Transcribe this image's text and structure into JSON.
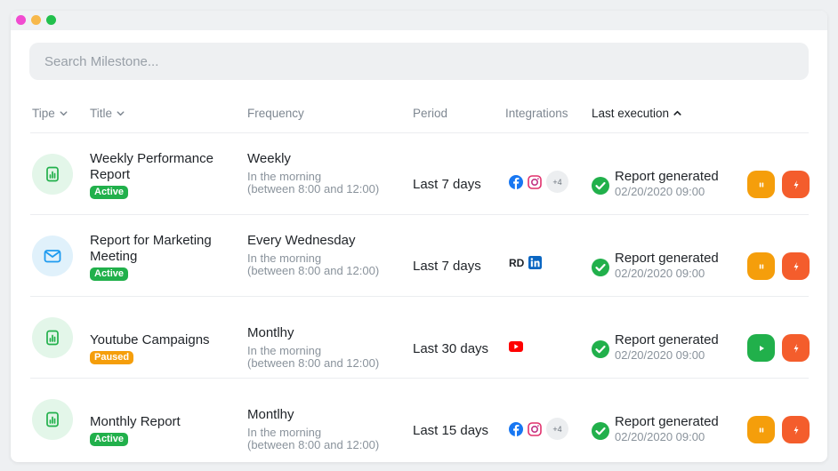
{
  "window": {
    "dots": [
      {
        "name": "close",
        "color": "#f14bd0"
      },
      {
        "name": "minimize",
        "color": "#f7b84b"
      },
      {
        "name": "maximize",
        "color": "#22c04d"
      }
    ]
  },
  "search": {
    "placeholder": "Search Milestone..."
  },
  "columns": {
    "tipe": "Tipe",
    "title": "Title",
    "frequency": "Frequency",
    "period": "Period",
    "integrations": "Integrations",
    "last_execution": "Last execution"
  },
  "colors": {
    "active": "#21b04b",
    "paused": "#f59e0b",
    "pause_btn": "#f59e0b",
    "play_btn": "#21b04b",
    "trigger_btn": "#f45d2c",
    "check": "#21b04b"
  },
  "rows": [
    {
      "type_icon": "chart-document-icon",
      "title": "Weekly Performance Report",
      "status": "Active",
      "frequency": "Weekly",
      "frequency_detail": "In the morning\n(between 8:00 and 12:00)",
      "period": "Last 7 days",
      "integrations": [
        "facebook-icon",
        "instagram-icon"
      ],
      "integrations_more": "+4",
      "execution_status": "Report generated",
      "execution_time": "02/20/2020 09:00",
      "primary_action": "pause"
    },
    {
      "type_icon": "mail-icon",
      "title": "Report for Marketing Meeting",
      "status": "Active",
      "frequency": "Every Wednesday",
      "frequency_detail": "In the morning\n(between 8:00 and 12:00)",
      "period": "Last 7 days",
      "integrations_text": "RD",
      "integrations": [
        "linkedin-icon"
      ],
      "execution_status": "Report generated",
      "execution_time": "02/20/2020 09:00",
      "primary_action": "pause"
    },
    {
      "type_icon": "chart-document-icon",
      "title": "Youtube Campaigns",
      "status": "Paused",
      "frequency": "Montlhy",
      "frequency_detail": "In the morning\n(between 8:00 and 12:00)",
      "period": "Last 30 days",
      "integrations": [
        "youtube-icon"
      ],
      "execution_status": "Report generated",
      "execution_time": "02/20/2020 09:00",
      "primary_action": "play"
    },
    {
      "type_icon": "chart-document-icon",
      "title": "Monthly Report",
      "status": "Active",
      "frequency": "Montlhy",
      "frequency_detail": "In the morning\n(between 8:00 and 12:00)",
      "period": "Last 15 days",
      "integrations": [
        "facebook-icon",
        "instagram-icon"
      ],
      "integrations_more": "+4",
      "execution_status": "Report generated",
      "execution_time": "02/20/2020 09:00",
      "primary_action": "pause"
    }
  ]
}
